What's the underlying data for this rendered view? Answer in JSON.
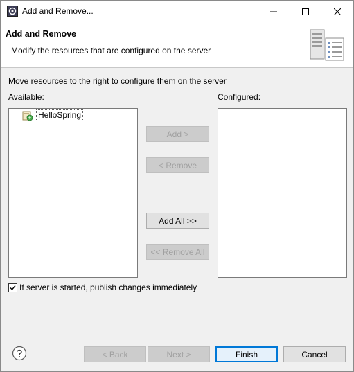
{
  "window": {
    "title": "Add and Remove...",
    "controls": [
      "minimize-icon",
      "maximize-icon",
      "close-icon"
    ]
  },
  "banner": {
    "title": "Add and Remove",
    "description": "Modify the resources that are configured on the server"
  },
  "intro": "Move resources to the right to configure them on the server",
  "available": {
    "label": "Available:",
    "items": [
      {
        "label": "HelloSpring",
        "icon": "web-project-icon"
      }
    ]
  },
  "configured": {
    "label": "Configured:",
    "items": []
  },
  "buttons": {
    "add": "Add >",
    "remove": "< Remove",
    "add_all": "Add All >>",
    "remove_all": "<< Remove All"
  },
  "publish_checkbox": {
    "label": "If server is started, publish changes immediately",
    "checked": true
  },
  "footer": {
    "back": "< Back",
    "next": "Next >",
    "finish": "Finish",
    "cancel": "Cancel"
  },
  "colors": {
    "default_button_border": "#0078d7",
    "disabled_text": "#a0a0a0"
  }
}
